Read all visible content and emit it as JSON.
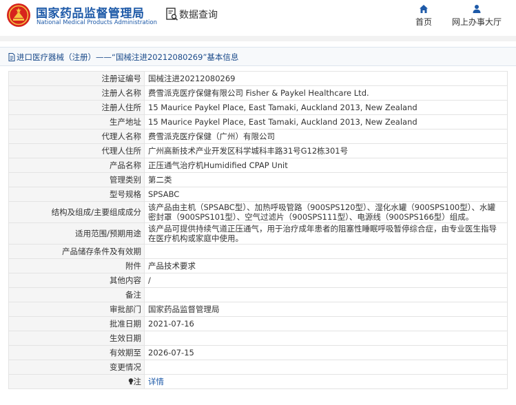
{
  "header": {
    "brand_cn": "国家药品监督管理局",
    "brand_en": "National Medical Products Administration",
    "query_label": "数据查询",
    "nav": [
      {
        "label": "首页",
        "icon": "home-icon"
      },
      {
        "label": "网上办事大厅",
        "icon": "user-icon"
      }
    ]
  },
  "breadcrumb": "进口医疗器械（注册）——“国械注进20212080269”基本信息",
  "rows": [
    {
      "label": "注册证编号",
      "value": "国械注进20212080269"
    },
    {
      "label": "注册人名称",
      "value": "费雪派克医疗保健有限公司 Fisher & Paykel Healthcare Ltd."
    },
    {
      "label": "注册人住所",
      "value": "15 Maurice Paykel Place, East Tamaki, Auckland 2013, New Zealand"
    },
    {
      "label": "生产地址",
      "value": "15 Maurice Paykel Place, East Tamaki, Auckland 2013, New Zealand"
    },
    {
      "label": "代理人名称",
      "value": "费雪派克医疗保健（广州）有限公司"
    },
    {
      "label": "代理人住所",
      "value": "广州高新技术产业开发区科学城科丰路31号G12栋301号"
    },
    {
      "label": "产品名称",
      "value": "正压通气治疗机Humidified CPAP Unit"
    },
    {
      "label": "管理类别",
      "value": "第二类"
    },
    {
      "label": "型号规格",
      "value": "SPSABC"
    },
    {
      "label": "结构及组成/主要组成成分",
      "value": "该产品由主机（SPSABC型）、加热呼吸管路（900SPS120型）、湿化水罐（900SPS100型）、水罐密封罩（900SPS101型）、空气过滤片（900SPS111型）、电源线（900SPS166型）组成。"
    },
    {
      "label": "适用范围/预期用途",
      "value": "该产品可提供持续气道正压通气，用于治疗成年患者的阻塞性睡眠呼吸暂停综合症，由专业医生指导在医疗机构或家庭中使用。"
    },
    {
      "label": "产品储存条件及有效期",
      "value": ""
    },
    {
      "label": "附件",
      "value": "产品技术要求"
    },
    {
      "label": "其他内容",
      "value": "/"
    },
    {
      "label": "备注",
      "value": ""
    },
    {
      "label": "审批部门",
      "value": "国家药品监督管理局"
    },
    {
      "label": "批准日期",
      "value": "2021-07-16"
    },
    {
      "label": "生效日期",
      "value": ""
    },
    {
      "label": "有效期至",
      "value": "2026-07-15"
    },
    {
      "label": "变更情况",
      "value": ""
    }
  ],
  "note": {
    "label": "注",
    "link_text": "详情"
  }
}
